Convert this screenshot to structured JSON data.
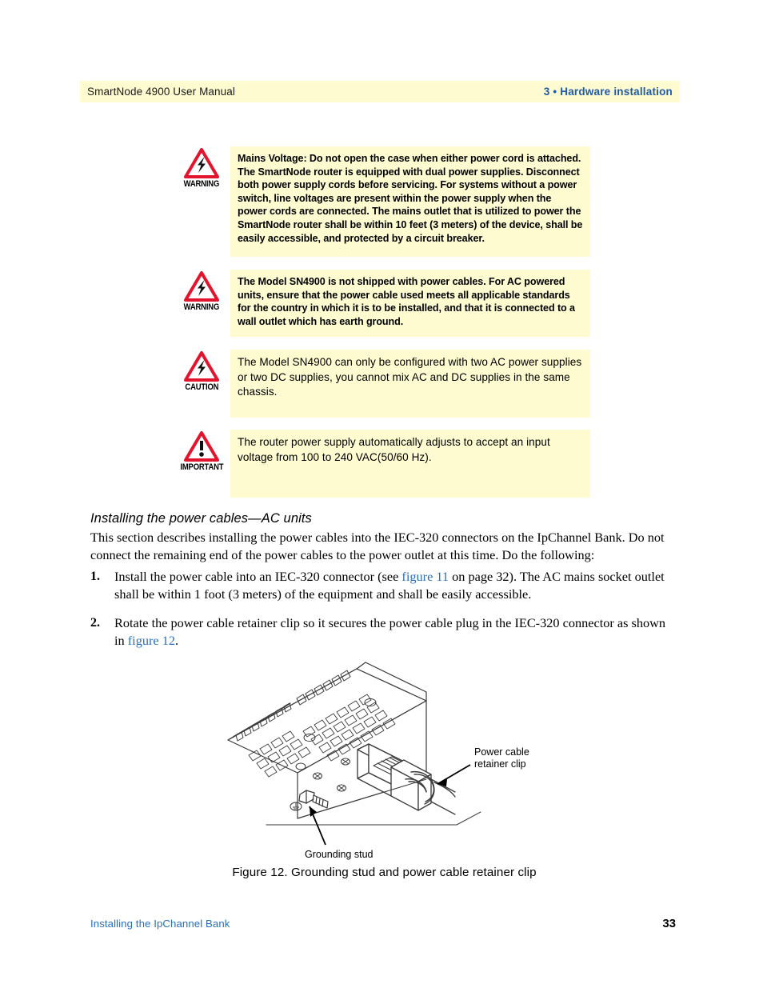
{
  "header": {
    "left_title": "SmartNode 4900 User Manual",
    "right_title": "3 • Hardware installation",
    "background_color": "#fdfbcf",
    "accent_color": "#1f5ba8"
  },
  "admonitions": [
    {
      "label": "WARNING",
      "icon": "warning-lightning-triangle-icon",
      "style": "bold",
      "text": "Mains Voltage: Do not open the case when either power cord is attached. The SmartNode router is equipped with dual power supplies. Disconnect both power supply cords before servicing. For systems without a power switch, line voltages are present within the power supply when the power cords are connected. The mains outlet that is utilized to power the SmartNode router shall be within 10 feet (3 meters) of the device, shall be easily accessible, and protected by a circuit breaker."
    },
    {
      "label": "WARNING",
      "icon": "warning-lightning-triangle-icon",
      "style": "bold",
      "text": "The Model SN4900 is not shipped with power cables. For AC powered units, ensure that the power cable used meets all applicable standards for the country in which it is to be installed, and that it is connected to a wall outlet which has earth ground."
    },
    {
      "label": "CAUTION",
      "icon": "caution-lightning-triangle-icon",
      "style": "regular",
      "text": "The Model SN4900 can only be configured with two AC power supplies or two DC supplies, you cannot mix AC and DC supplies in the same chassis."
    },
    {
      "label": "IMPORTANT",
      "icon": "important-exclamation-triangle-icon",
      "style": "regular",
      "text": "The router power supply automatically adjusts to accept an input voltage from 100 to 240 VAC(50/60 Hz)."
    }
  ],
  "section": {
    "heading": "Installing the power cables—AC units",
    "intro": "This section describes installing the power cables into the IEC-320 connectors on the IpChannel Bank. Do not connect the remaining end of the power cables to the power outlet at this time. Do the following:"
  },
  "steps": [
    {
      "number": "1.",
      "part_1": "Install the power cable into an IEC-320 connector (see ",
      "link": "figure 11",
      "part_2": " on page 32). The AC mains socket outlet shall be within 1 foot (3 meters) of the equipment and shall be easily accessible."
    },
    {
      "number": "2.",
      "part_1": "Rotate the power cable retainer clip so it secures the power cable plug in the IEC-320 connector as shown in ",
      "link": "figure 12",
      "part_2": "."
    }
  ],
  "figure": {
    "caption": "Figure 12. Grounding stud and power cable retainer clip",
    "callout_power_cable_line1": "Power cable",
    "callout_power_cable_line2": "retainer clip",
    "callout_grounding_stud": "Grounding stud"
  },
  "footer": {
    "left": "Installing the IpChannel Bank",
    "page_number": "33",
    "link_color": "#2a6fbb"
  }
}
